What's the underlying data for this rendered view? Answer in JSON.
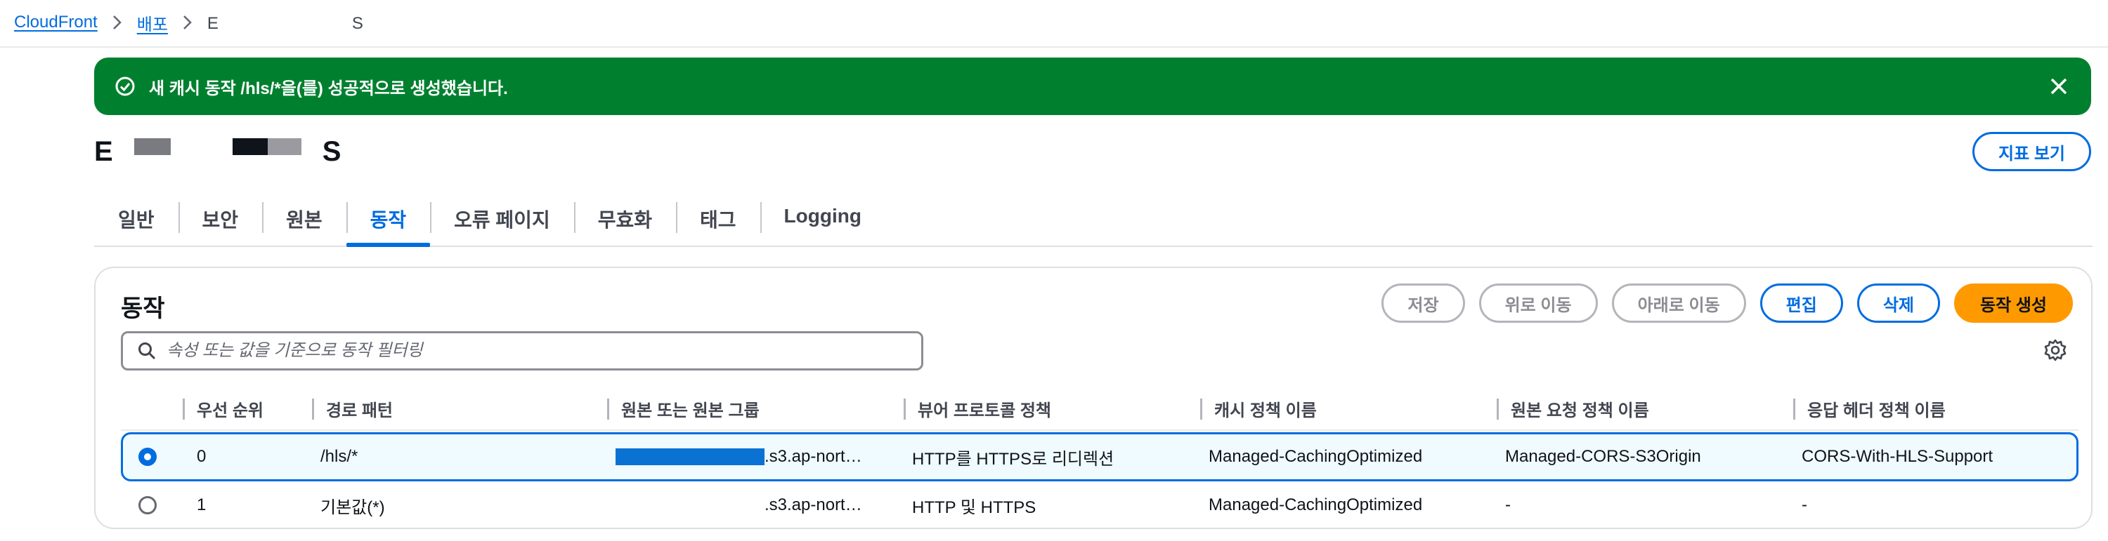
{
  "breadcrumb": {
    "items": [
      "CloudFront",
      "배포"
    ],
    "current_start": "E",
    "current_end": "S"
  },
  "flash": {
    "message": "새 캐시 동작 /hls/*을(를) 성공적으로 생성했습니다."
  },
  "header": {
    "title_start": "E",
    "title_end": "S",
    "metrics_button": "지표 보기"
  },
  "tabs": [
    "일반",
    "보안",
    "원본",
    "동작",
    "오류 페이지",
    "무효화",
    "태그",
    "Logging"
  ],
  "active_tab": "동작",
  "behaviors": {
    "title": "동작",
    "buttons": {
      "save": "저장",
      "move_up": "위로 이동",
      "move_down": "아래로 이동",
      "edit": "편집",
      "delete": "삭제",
      "create": "동작 생성"
    },
    "filter_placeholder": "속성 또는 값을 기준으로 동작 필터링",
    "columns": [
      "우선 순위",
      "경로 패턴",
      "원본 또는 원본 그룹",
      "뷰어 프로토콜 정책",
      "캐시 정책 이름",
      "원본 요청 정책 이름",
      "응답 헤더 정책 이름"
    ],
    "rows": [
      {
        "selected": true,
        "priority": "0",
        "path": "/hls/*",
        "origin": ".s3.ap-nort…",
        "viewer_protocol": "HTTP를 HTTPS로 리디렉션",
        "cache_policy": "Managed-CachingOptimized",
        "origin_request_policy": "Managed-CORS-S3Origin",
        "response_headers_policy": "CORS-With-HLS-Support"
      },
      {
        "selected": false,
        "priority": "1",
        "path": "기본값(*)",
        "origin": ".s3.ap-nort…",
        "viewer_protocol": "HTTP 및 HTTPS",
        "cache_policy": "Managed-CachingOptimized",
        "origin_request_policy": "-",
        "response_headers_policy": "-"
      }
    ]
  },
  "colors": {
    "primary": "#006ce0",
    "success": "#00802f",
    "accent": "#ff9900"
  }
}
